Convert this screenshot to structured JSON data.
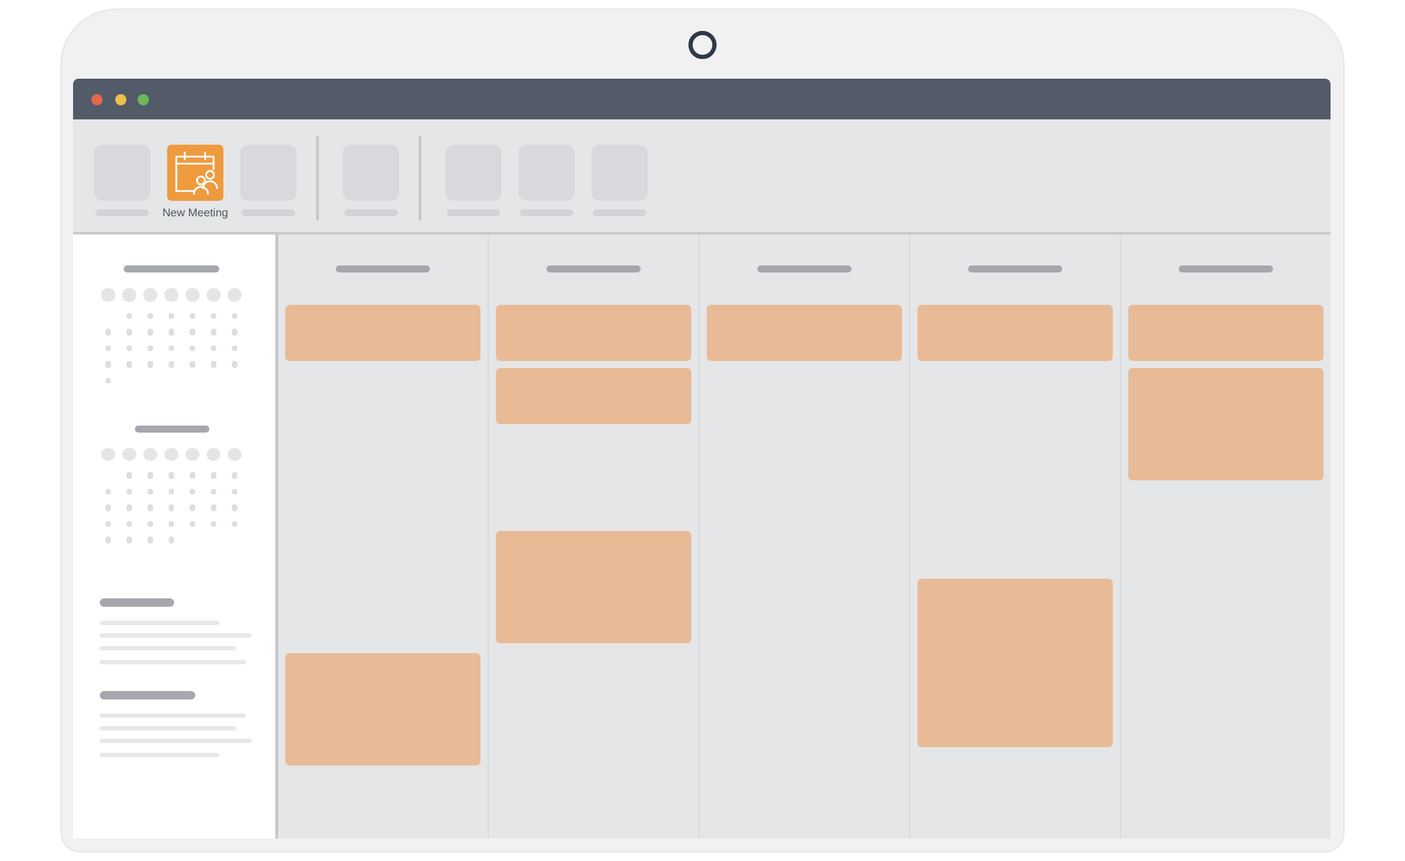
{
  "window": {
    "controls": [
      {
        "color": "#e2684f"
      },
      {
        "color": "#efbf4a"
      },
      {
        "color": "#6bb85a"
      }
    ]
  },
  "toolbar": {
    "items": [
      {
        "kind": "blank"
      },
      {
        "kind": "action",
        "label": "New Meeting"
      },
      {
        "kind": "blank"
      },
      {
        "kind": "separator"
      },
      {
        "kind": "blank"
      },
      {
        "kind": "separator"
      },
      {
        "kind": "blank"
      },
      {
        "kind": "blank"
      },
      {
        "kind": "blank"
      }
    ]
  },
  "sidebar": {
    "mini_calendars": [
      {
        "heading": {
          "kind": "long"
        },
        "weeks": [
          [
            {
              "kind": "blank"
            },
            {
              "kind": "day"
            },
            {
              "kind": "day"
            },
            {
              "kind": "day"
            },
            {
              "kind": "day"
            },
            {
              "kind": "day"
            },
            {
              "kind": "day"
            }
          ],
          [
            {
              "kind": "day"
            },
            {
              "kind": "day"
            },
            {
              "kind": "day"
            },
            {
              "kind": "day"
            },
            {
              "kind": "day"
            },
            {
              "kind": "day"
            },
            {
              "kind": "day"
            }
          ],
          [
            {
              "kind": "day"
            },
            {
              "kind": "day"
            },
            {
              "kind": "day"
            },
            {
              "kind": "day"
            },
            {
              "kind": "day"
            },
            {
              "kind": "day"
            },
            {
              "kind": "day"
            }
          ],
          [
            {
              "kind": "day"
            },
            {
              "kind": "day"
            },
            {
              "kind": "day"
            },
            {
              "kind": "day"
            },
            {
              "kind": "day"
            },
            {
              "kind": "day"
            },
            {
              "kind": "day"
            }
          ],
          [
            {
              "kind": "day"
            }
          ]
        ]
      },
      {
        "heading": {
          "kind": "short"
        },
        "weeks": [
          [
            {
              "kind": "blank"
            },
            {
              "kind": "day"
            },
            {
              "kind": "day"
            },
            {
              "kind": "day"
            },
            {
              "kind": "day"
            },
            {
              "kind": "day"
            },
            {
              "kind": "day"
            }
          ],
          [
            {
              "kind": "day"
            },
            {
              "kind": "day"
            },
            {
              "kind": "day"
            },
            {
              "kind": "day"
            },
            {
              "kind": "day"
            },
            {
              "kind": "day"
            },
            {
              "kind": "day"
            }
          ],
          [
            {
              "kind": "day"
            },
            {
              "kind": "day"
            },
            {
              "kind": "day"
            },
            {
              "kind": "day"
            },
            {
              "kind": "day"
            },
            {
              "kind": "day"
            },
            {
              "kind": "day"
            }
          ],
          [
            {
              "kind": "day"
            },
            {
              "kind": "day"
            },
            {
              "kind": "day"
            },
            {
              "kind": "day"
            },
            {
              "kind": "day"
            },
            {
              "kind": "day"
            },
            {
              "kind": "day"
            }
          ],
          [
            {
              "kind": "day"
            },
            {
              "kind": "day"
            },
            {
              "kind": "day"
            },
            {
              "kind": "day"
            }
          ]
        ]
      }
    ],
    "sections": [
      {
        "heading": {
          "kind": "short"
        },
        "lines": [
          {
            "kind": "short"
          },
          {
            "kind": "full"
          },
          {
            "kind": "long"
          },
          {
            "kind": "longer"
          }
        ]
      },
      {
        "heading": {
          "kind": "long"
        },
        "lines": [
          {
            "kind": "longer"
          },
          {
            "kind": "long"
          },
          {
            "kind": "full"
          },
          {
            "kind": "short"
          }
        ]
      }
    ]
  },
  "calendar": {
    "days": [
      {
        "events": [
          {
            "kind": "short"
          },
          {
            "kind": "medium"
          }
        ]
      },
      {
        "events": [
          {
            "kind": "short"
          },
          {
            "kind": "short"
          },
          {
            "kind": "medium"
          }
        ]
      },
      {
        "events": [
          {
            "kind": "short"
          }
        ]
      },
      {
        "events": [
          {
            "kind": "short"
          },
          {
            "kind": "long"
          }
        ]
      },
      {
        "events": [
          {
            "kind": "short"
          },
          {
            "kind": "medium"
          }
        ]
      }
    ]
  }
}
